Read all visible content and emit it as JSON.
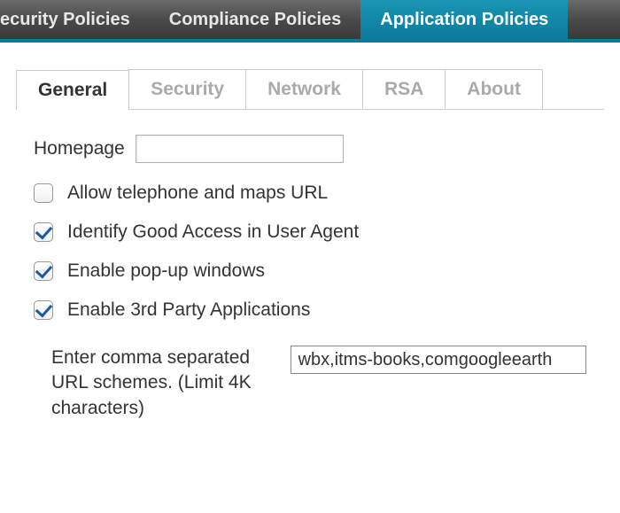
{
  "topNav": {
    "items": [
      {
        "label": "ecurity Policies",
        "active": false
      },
      {
        "label": "Compliance Policies",
        "active": false
      },
      {
        "label": "Application Policies",
        "active": true
      }
    ]
  },
  "subTabs": {
    "items": [
      {
        "label": "General",
        "active": true
      },
      {
        "label": "Security",
        "active": false
      },
      {
        "label": "Network",
        "active": false
      },
      {
        "label": "RSA",
        "active": false
      },
      {
        "label": "About",
        "active": false
      }
    ]
  },
  "form": {
    "homepage": {
      "label": "Homepage",
      "value": ""
    },
    "checkboxes": [
      {
        "label": "Allow telephone and maps URL",
        "checked": false
      },
      {
        "label": "Identify Good Access in User Agent",
        "checked": true
      },
      {
        "label": "Enable pop-up windows",
        "checked": true
      },
      {
        "label": "Enable 3rd Party Applications",
        "checked": true
      }
    ],
    "urlSchemes": {
      "label": "Enter comma separated URL schemes. (Limit 4K characters)",
      "value": "wbx,itms-books,comgoogleearth"
    }
  }
}
